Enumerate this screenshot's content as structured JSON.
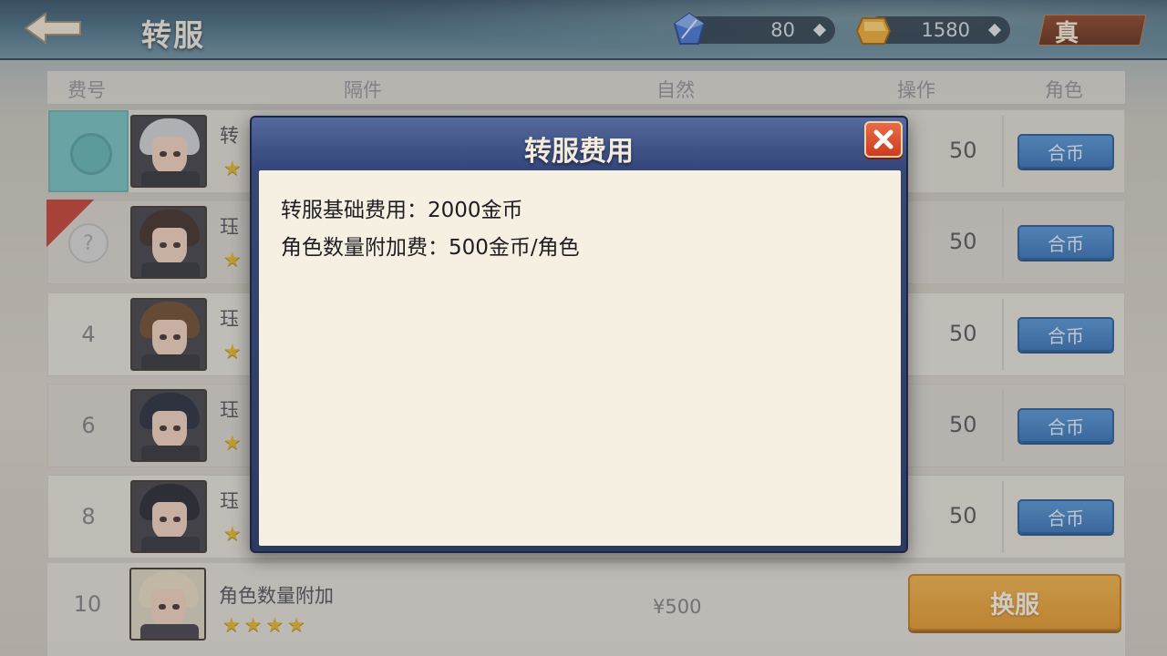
{
  "header": {
    "title": "转服",
    "gem_amount": "80",
    "gold_amount": "1580",
    "vip_label": "真"
  },
  "table": {
    "columns": [
      "费号",
      "隔件",
      "自然",
      "操作",
      "角色"
    ],
    "rows": [
      {
        "index": "",
        "name": "转",
        "stars": 1,
        "cost": "50",
        "button": "合币",
        "hair": "#cfd2d4",
        "selected": true
      },
      {
        "index": "?",
        "name": "珏",
        "stars": 1,
        "cost": "50",
        "button": "合币",
        "hair": "#3a2620",
        "ribbon": true
      },
      {
        "index": "4",
        "name": "珏",
        "stars": 1,
        "cost": "50",
        "button": "合币",
        "hair": "#6a4628"
      },
      {
        "index": "6",
        "name": "珏",
        "stars": 1,
        "cost": "50",
        "button": "合币",
        "hair": "#1e2434"
      },
      {
        "index": "8",
        "name": "珏",
        "stars": 1,
        "cost": "50",
        "button": "合币",
        "hair": "#1c1e28"
      }
    ],
    "footer": {
      "index": "10",
      "label": "角色数量附加",
      "stars": 4,
      "price": "¥500",
      "transfer_button": "换服"
    }
  },
  "modal": {
    "title": "转服费用",
    "lines": [
      "转服基础费用：2000金币",
      "角色数量附加费：500金币/角色"
    ]
  },
  "colors": {
    "accent_blue": "#2f6fb8",
    "accent_orange": "#e39422",
    "modal_frame": "#3a4a74",
    "close_red": "#cc3c20"
  }
}
